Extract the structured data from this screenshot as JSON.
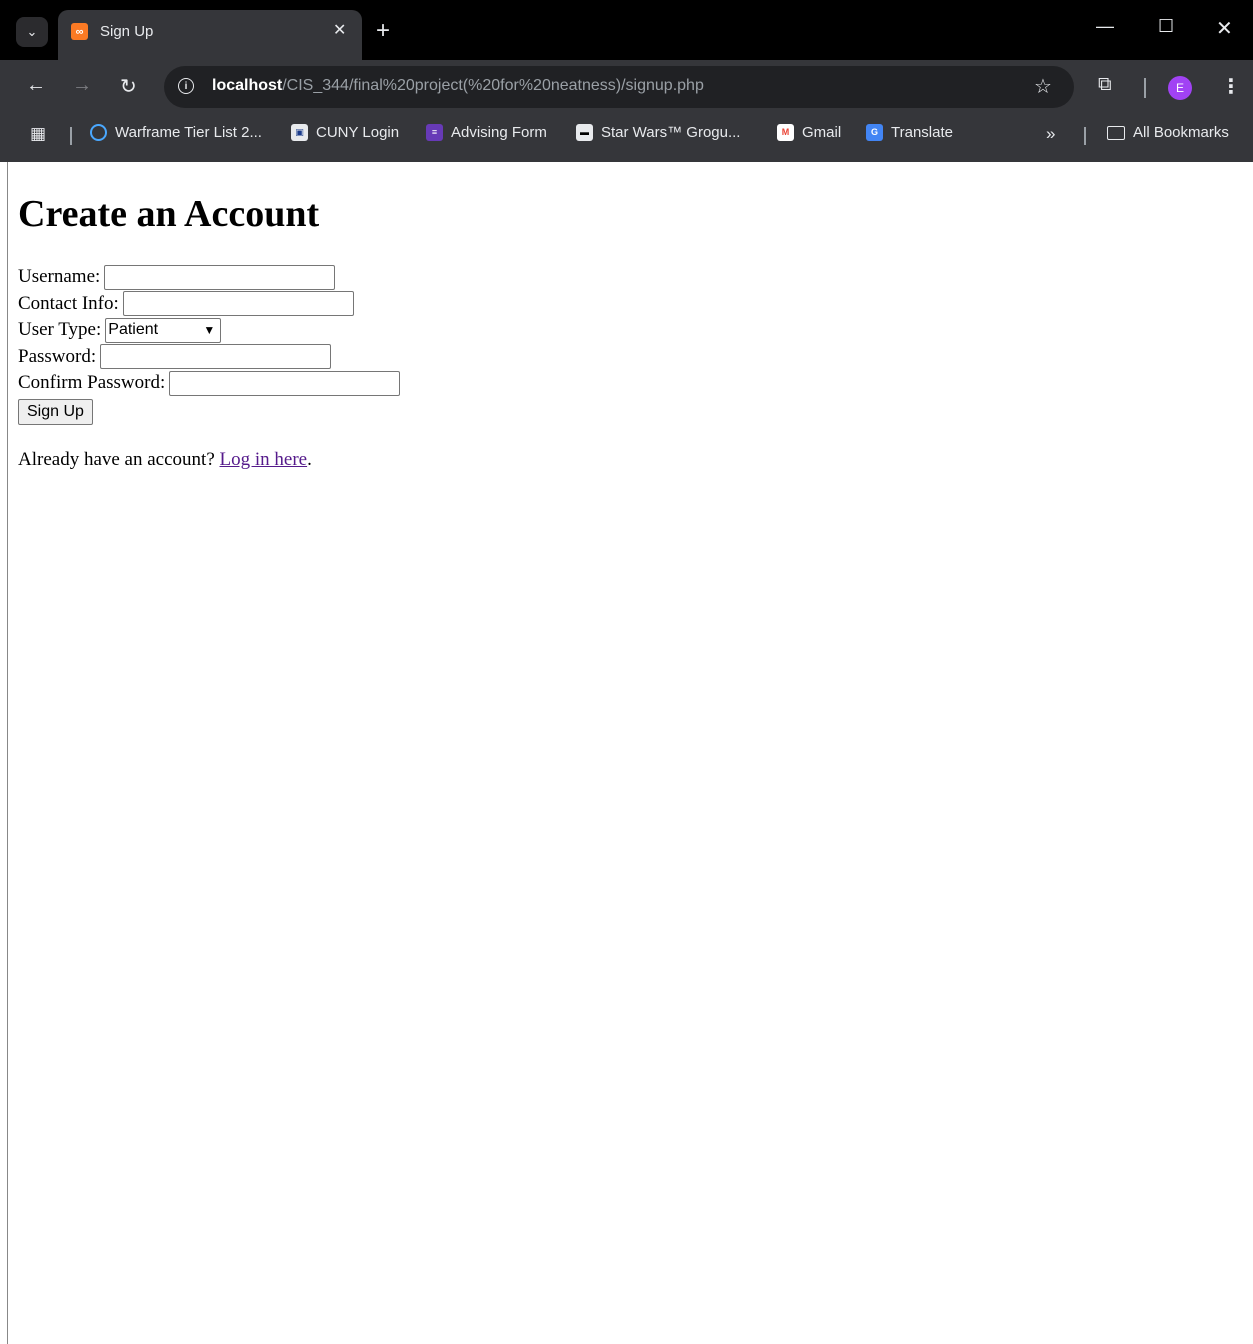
{
  "browser": {
    "tab_title": "Sign Up",
    "url_host": "localhost",
    "url_path": "/CIS_344/final%20project(%20for%20neatness)/signup.php",
    "avatar_letter": "E",
    "bookmarks": [
      {
        "label": "Warframe Tier List 2...",
        "icon": "warframe-icon"
      },
      {
        "label": "CUNY Login",
        "icon": "cuny-icon"
      },
      {
        "label": "Advising Form",
        "icon": "forms-icon"
      },
      {
        "label": "Star Wars™ Grogu...",
        "icon": "starwars-icon"
      },
      {
        "label": "Gmail",
        "icon": "gmail-icon"
      },
      {
        "label": "Translate",
        "icon": "translate-icon"
      }
    ],
    "all_bookmarks_label": "All Bookmarks"
  },
  "page": {
    "heading": "Create an Account",
    "fields": {
      "username_label": "Username:",
      "contact_label": "Contact Info:",
      "user_type_label": "User Type:",
      "user_type_value": "Patient",
      "password_label": "Password:",
      "confirm_label": "Confirm Password:"
    },
    "submit_label": "Sign Up",
    "footer_text": "Already have an account?",
    "login_link": "Log in here",
    "footer_end": "."
  }
}
